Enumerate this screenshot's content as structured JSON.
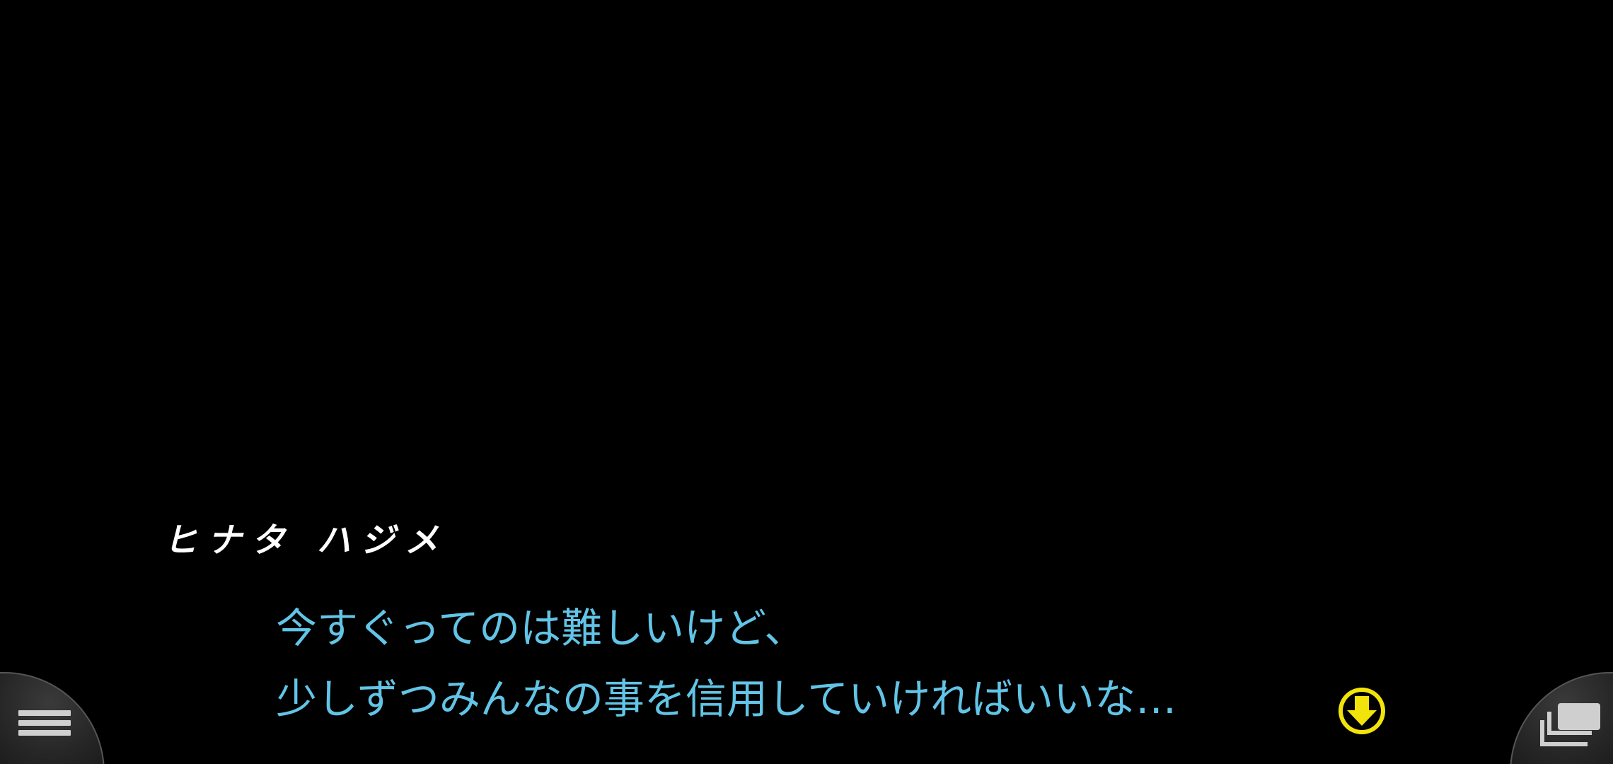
{
  "scene": {
    "background_color": "#000000"
  },
  "speaker": {
    "name": "ヒナタ ハジメ",
    "color": "#ffffff"
  },
  "dialogue": {
    "lines": [
      "今すぐってのは難しいけど、",
      "少しずつみんなの事を信用していければいいな…"
    ],
    "color": "#62c4e6"
  },
  "controls": {
    "advance_icon": "arrow-down-circle-icon",
    "advance_color": "#f2e40a",
    "menu_icon": "hamburger-menu-icon",
    "backlog_icon": "backlog-stack-icon"
  }
}
